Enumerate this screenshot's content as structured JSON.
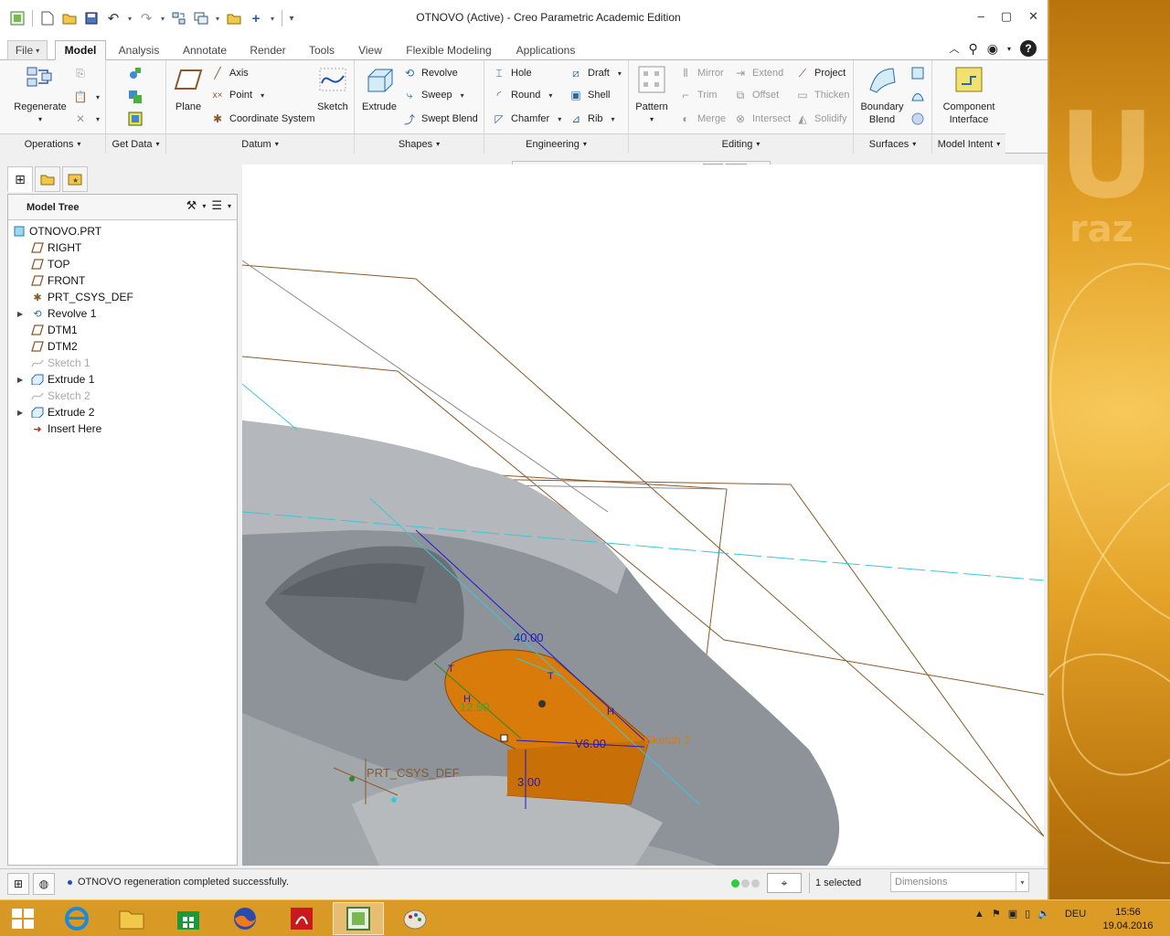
{
  "window": {
    "title": "OTNOVO (Active) - Creo Parametric Academic Edition"
  },
  "quick_access": [
    "new-icon",
    "open-icon",
    "save-icon",
    "undo-icon",
    "redo-icon",
    "regenerate-icon",
    "windows-icon",
    "close-icon",
    "customize-icon"
  ],
  "tabs": [
    "File",
    "Model",
    "Analysis",
    "Annotate",
    "Render",
    "Tools",
    "View",
    "Flexible Modeling",
    "Applications"
  ],
  "active_tab": "Model",
  "ribbon": {
    "operations": {
      "regenerate": "Regenerate",
      "footer": "Operations"
    },
    "get_data": {
      "footer": "Get Data"
    },
    "datum": {
      "plane": "Plane",
      "axis": "Axis",
      "point": "Point",
      "csys": "Coordinate System",
      "sketch": "Sketch",
      "footer": "Datum"
    },
    "shapes": {
      "extrude": "Extrude",
      "revolve": "Revolve",
      "sweep": "Sweep",
      "swept_blend": "Swept Blend",
      "footer": "Shapes"
    },
    "engineering": {
      "hole": "Hole",
      "round": "Round",
      "chamfer": "Chamfer",
      "draft": "Draft",
      "shell": "Shell",
      "rib": "Rib",
      "footer": "Engineering"
    },
    "editing": {
      "pattern": "Pattern",
      "mirror": "Mirror",
      "trim": "Trim",
      "merge": "Merge",
      "extend": "Extend",
      "offset": "Offset",
      "intersect": "Intersect",
      "project": "Project",
      "thicken": "Thicken",
      "solidify": "Solidify",
      "footer": "Editing"
    },
    "surfaces": {
      "boundary_blend_1": "Boundary",
      "boundary_blend_2": "Blend",
      "footer": "Surfaces"
    },
    "model_intent": {
      "component_1": "Component",
      "component_2": "Interface",
      "footer": "Model Intent"
    }
  },
  "model_tree": {
    "title": "Model Tree",
    "items": [
      {
        "label": "OTNOVO.PRT",
        "icon": "part-icon",
        "expandable": false,
        "dim": false
      },
      {
        "label": "RIGHT",
        "icon": "datum-plane-icon",
        "expandable": false,
        "dim": false
      },
      {
        "label": "TOP",
        "icon": "datum-plane-icon",
        "expandable": false,
        "dim": false
      },
      {
        "label": "FRONT",
        "icon": "datum-plane-icon",
        "expandable": false,
        "dim": false
      },
      {
        "label": "PRT_CSYS_DEF",
        "icon": "csys-icon",
        "expandable": false,
        "dim": false
      },
      {
        "label": "Revolve 1",
        "icon": "revolve-icon",
        "expandable": true,
        "dim": false
      },
      {
        "label": "DTM1",
        "icon": "datum-plane-icon",
        "expandable": false,
        "dim": false
      },
      {
        "label": "DTM2",
        "icon": "datum-plane-icon",
        "expandable": false,
        "dim": false
      },
      {
        "label": "Sketch 1",
        "icon": "sketch-icon",
        "expandable": false,
        "dim": true
      },
      {
        "label": "Extrude 1",
        "icon": "extrude-icon",
        "expandable": true,
        "dim": false
      },
      {
        "label": "Sketch 2",
        "icon": "sketch-icon",
        "expandable": false,
        "dim": true
      },
      {
        "label": "Extrude 2",
        "icon": "extrude-icon",
        "expandable": true,
        "dim": false
      },
      {
        "label": "Insert Here",
        "icon": "insert-arrow-icon",
        "expandable": false,
        "dim": false
      }
    ]
  },
  "viewport": {
    "dimensions": {
      "d40": "40.00",
      "d12": "12.50",
      "d6": "V6.00",
      "d3": "3.00"
    },
    "labels": {
      "csys": "PRT_CSYS_DEF",
      "sketch": "Sketch 2",
      "t1": "T",
      "t2": "T",
      "h1": "H",
      "h2": "H"
    }
  },
  "status": {
    "message": "OTNOVO regeneration completed successfully.",
    "selected": "1 selected",
    "filter": "Dimensions"
  },
  "taskbar": {
    "lang": "DEU",
    "time": "15:56",
    "date": "19.04.2016"
  },
  "wallpaper": {
    "logo_big": "U",
    "logo_small": "raz"
  },
  "colors": {
    "accent_orange": "#d97b0a",
    "model_gray": "#8d9399",
    "dimension_blue": "#1a1ad0",
    "datum_cyan": "#38c8d8",
    "datum_brown": "#8a5a2a"
  }
}
